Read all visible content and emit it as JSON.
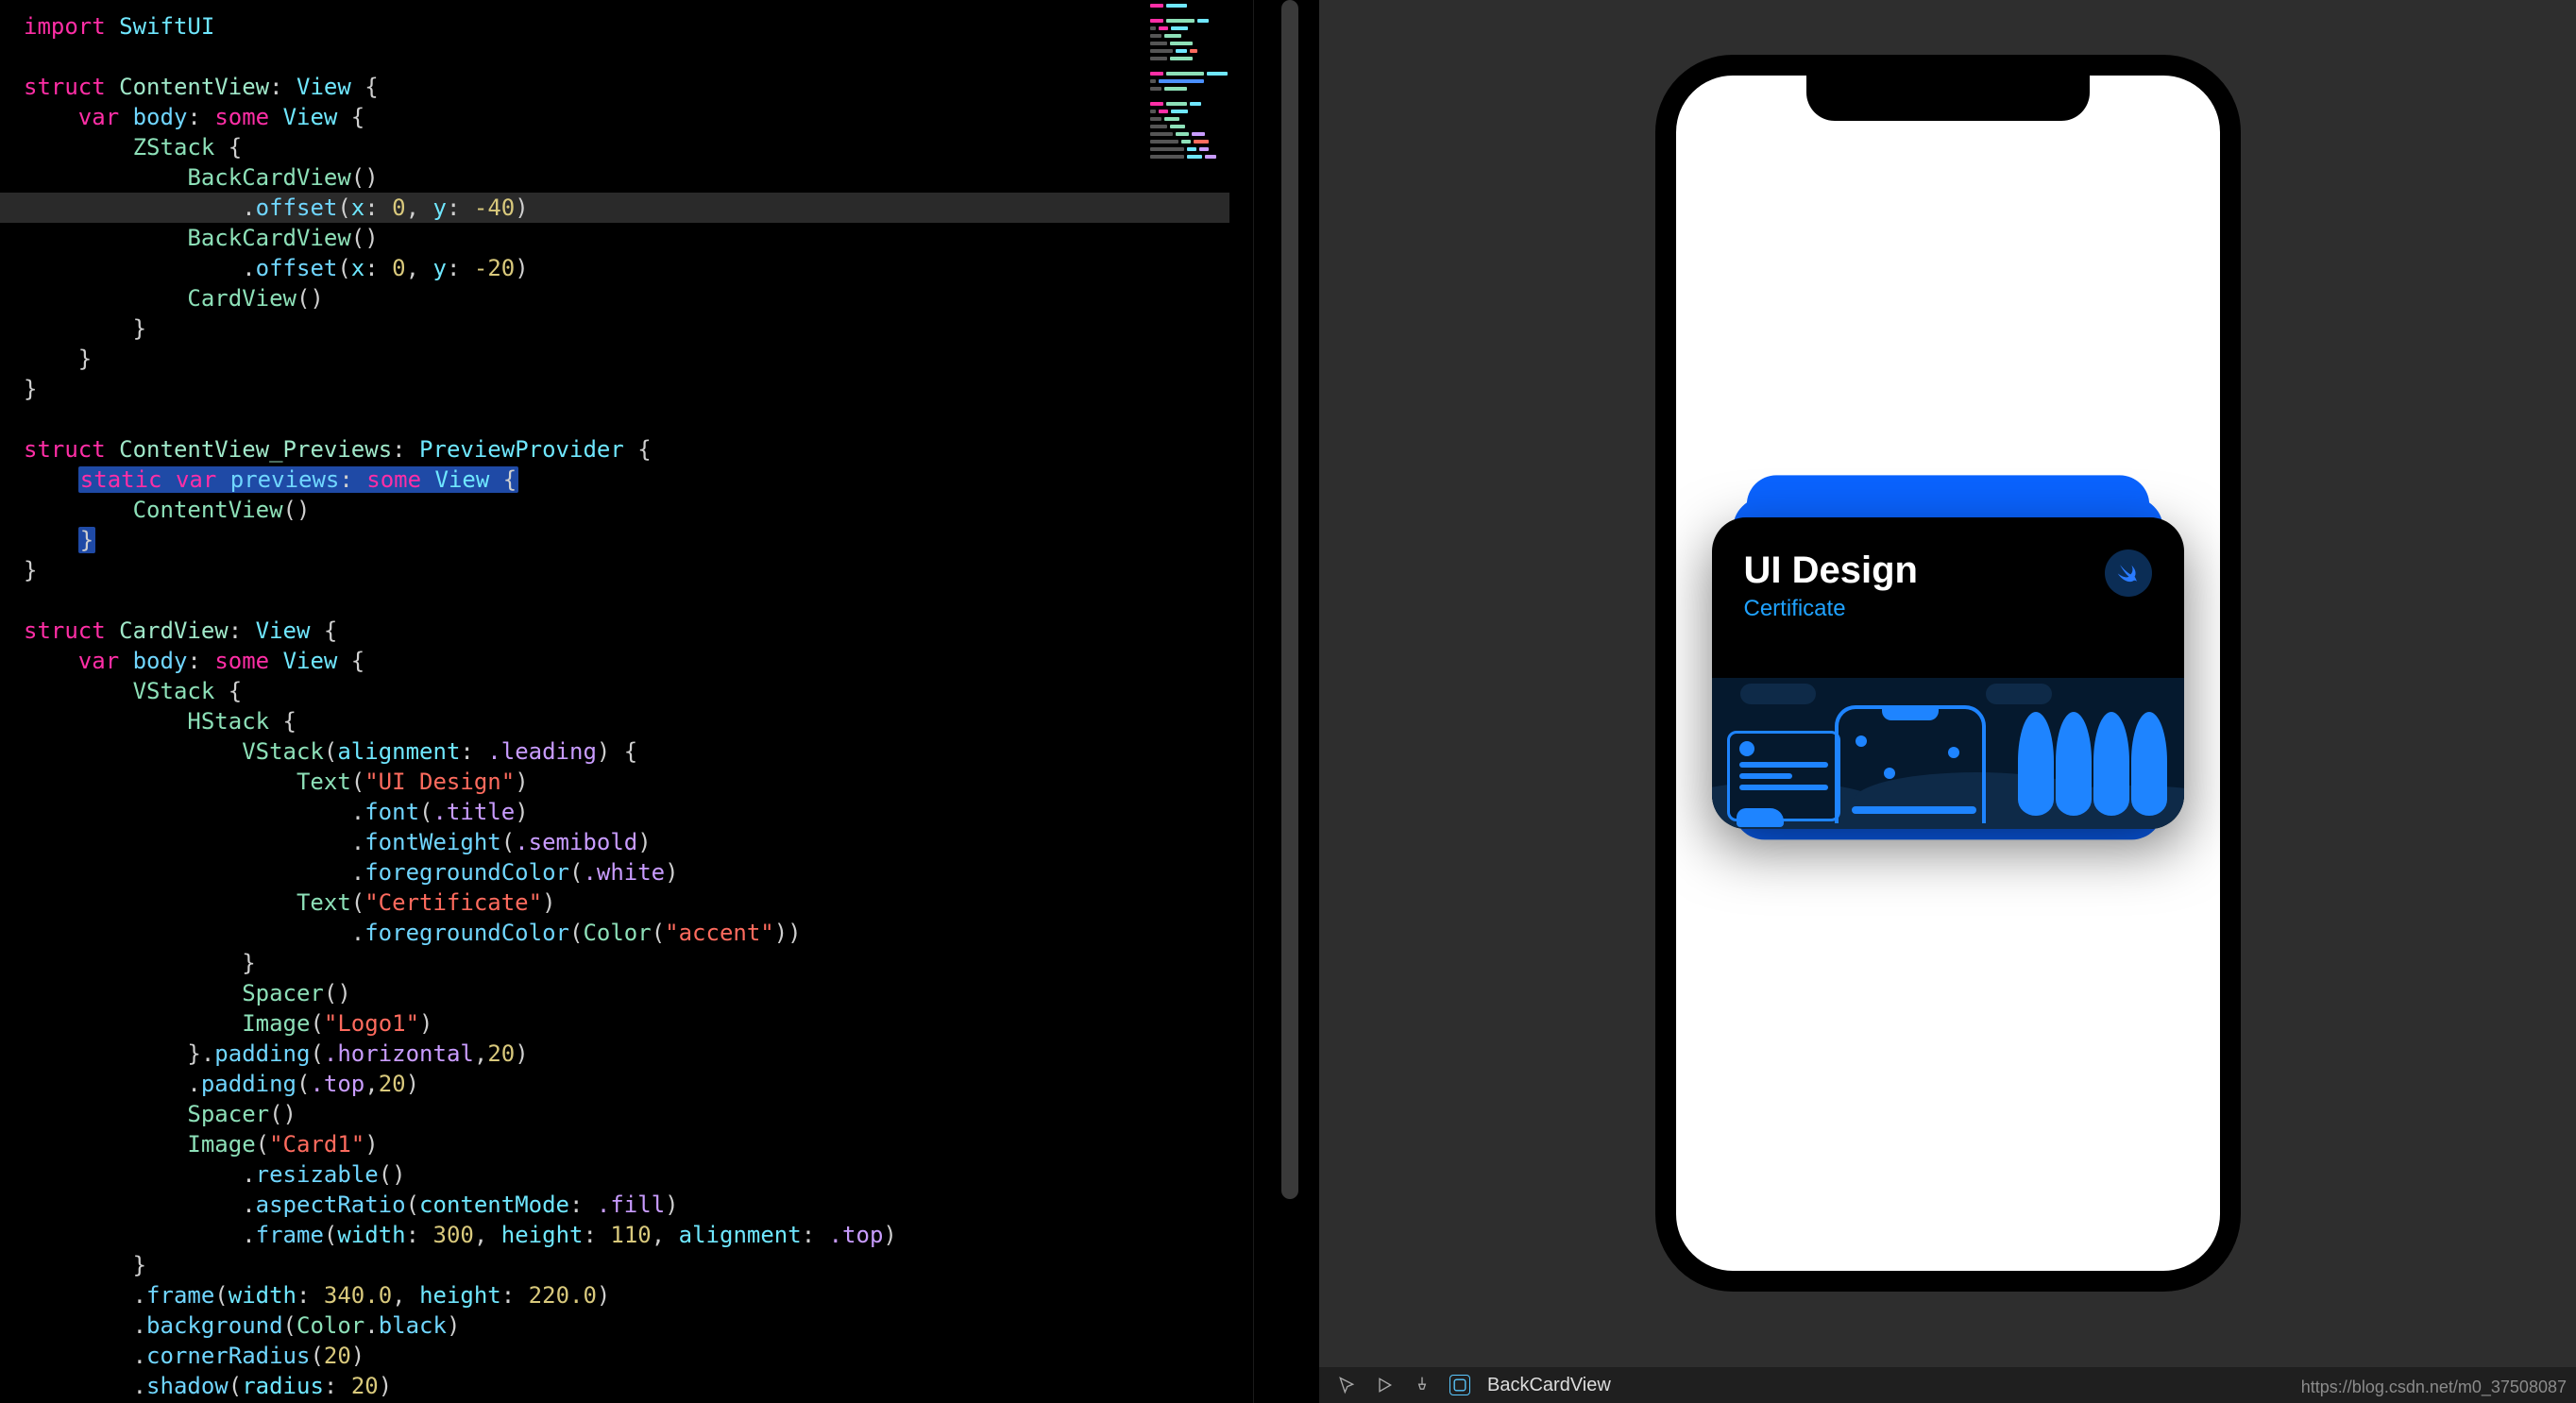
{
  "code": {
    "lines": [
      {
        "indent": 0,
        "tokens": [
          [
            "kw",
            "import"
          ],
          [
            "sp",
            " "
          ],
          [
            "type",
            "SwiftUI"
          ]
        ]
      },
      {
        "indent": 0,
        "tokens": []
      },
      {
        "indent": 0,
        "tokens": [
          [
            "kw",
            "struct"
          ],
          [
            "sp",
            " "
          ],
          [
            "dtype",
            "ContentView"
          ],
          [
            "punc",
            ": "
          ],
          [
            "type",
            "View"
          ],
          [
            "punc",
            " {"
          ]
        ]
      },
      {
        "indent": 1,
        "tokens": [
          [
            "kw",
            "var"
          ],
          [
            "sp",
            " "
          ],
          [
            "fn",
            "body"
          ],
          [
            "punc",
            ": "
          ],
          [
            "kw",
            "some"
          ],
          [
            "sp",
            " "
          ],
          [
            "type",
            "View"
          ],
          [
            "punc",
            " {"
          ]
        ]
      },
      {
        "indent": 2,
        "tokens": [
          [
            "call",
            "ZStack"
          ],
          [
            "punc",
            " {"
          ]
        ]
      },
      {
        "indent": 3,
        "tokens": [
          [
            "call",
            "BackCardView"
          ],
          [
            "punc",
            "()"
          ]
        ]
      },
      {
        "indent": 4,
        "hl": true,
        "tokens": [
          [
            "punc",
            "."
          ],
          [
            "fn",
            "offset"
          ],
          [
            "punc",
            "("
          ],
          [
            "param",
            "x"
          ],
          [
            "punc",
            ": "
          ],
          [
            "num",
            "0"
          ],
          [
            "punc",
            ", "
          ],
          [
            "param",
            "y"
          ],
          [
            "punc",
            ": "
          ],
          [
            "num",
            "-40"
          ],
          [
            "punc",
            ")"
          ]
        ]
      },
      {
        "indent": 3,
        "tokens": [
          [
            "call",
            "BackCardView"
          ],
          [
            "punc",
            "()"
          ]
        ]
      },
      {
        "indent": 4,
        "tokens": [
          [
            "punc",
            "."
          ],
          [
            "fn",
            "offset"
          ],
          [
            "punc",
            "("
          ],
          [
            "param",
            "x"
          ],
          [
            "punc",
            ": "
          ],
          [
            "num",
            "0"
          ],
          [
            "punc",
            ", "
          ],
          [
            "param",
            "y"
          ],
          [
            "punc",
            ": "
          ],
          [
            "num",
            "-20"
          ],
          [
            "punc",
            ")"
          ]
        ]
      },
      {
        "indent": 3,
        "tokens": [
          [
            "call",
            "CardView"
          ],
          [
            "punc",
            "()"
          ]
        ]
      },
      {
        "indent": 2,
        "tokens": [
          [
            "punc",
            "}"
          ]
        ]
      },
      {
        "indent": 1,
        "tokens": [
          [
            "punc",
            "}"
          ]
        ]
      },
      {
        "indent": 0,
        "tokens": [
          [
            "punc",
            "}"
          ]
        ]
      },
      {
        "indent": 0,
        "tokens": []
      },
      {
        "indent": 0,
        "tokens": [
          [
            "kw",
            "struct"
          ],
          [
            "sp",
            " "
          ],
          [
            "dtype",
            "ContentView_Previews"
          ],
          [
            "punc",
            ": "
          ],
          [
            "type",
            "PreviewProvider"
          ],
          [
            "punc",
            " {"
          ]
        ]
      },
      {
        "indent": 1,
        "sel": true,
        "tokens": [
          [
            "kw",
            "static"
          ],
          [
            "sp",
            " "
          ],
          [
            "kw",
            "var"
          ],
          [
            "sp",
            " "
          ],
          [
            "fn",
            "previews"
          ],
          [
            "punc",
            ": "
          ],
          [
            "kw",
            "some"
          ],
          [
            "sp",
            " "
          ],
          [
            "type",
            "View"
          ],
          [
            "punc",
            " {"
          ]
        ]
      },
      {
        "indent": 2,
        "tokens": [
          [
            "call",
            "ContentView"
          ],
          [
            "punc",
            "()"
          ]
        ]
      },
      {
        "indent": 1,
        "sel": true,
        "tokens": [
          [
            "punc",
            "}"
          ]
        ]
      },
      {
        "indent": 0,
        "tokens": [
          [
            "punc",
            "}"
          ]
        ]
      },
      {
        "indent": 0,
        "tokens": []
      },
      {
        "indent": 0,
        "tokens": [
          [
            "kw",
            "struct"
          ],
          [
            "sp",
            " "
          ],
          [
            "dtype",
            "CardView"
          ],
          [
            "punc",
            ": "
          ],
          [
            "type",
            "View"
          ],
          [
            "punc",
            " {"
          ]
        ]
      },
      {
        "indent": 1,
        "tokens": [
          [
            "kw",
            "var"
          ],
          [
            "sp",
            " "
          ],
          [
            "fn",
            "body"
          ],
          [
            "punc",
            ": "
          ],
          [
            "kw",
            "some"
          ],
          [
            "sp",
            " "
          ],
          [
            "type",
            "View"
          ],
          [
            "punc",
            " {"
          ]
        ]
      },
      {
        "indent": 2,
        "tokens": [
          [
            "call",
            "VStack"
          ],
          [
            "punc",
            " {"
          ]
        ]
      },
      {
        "indent": 3,
        "tokens": [
          [
            "call",
            "HStack"
          ],
          [
            "punc",
            " {"
          ]
        ]
      },
      {
        "indent": 4,
        "tokens": [
          [
            "call",
            "VStack"
          ],
          [
            "punc",
            "("
          ],
          [
            "param",
            "alignment"
          ],
          [
            "punc",
            ": "
          ],
          [
            "enum",
            ".leading"
          ],
          [
            "punc",
            ") {"
          ]
        ]
      },
      {
        "indent": 5,
        "tokens": [
          [
            "call",
            "Text"
          ],
          [
            "punc",
            "("
          ],
          [
            "str",
            "\"UI Design\""
          ],
          [
            "punc",
            ")"
          ]
        ]
      },
      {
        "indent": 6,
        "tokens": [
          [
            "punc",
            "."
          ],
          [
            "fn",
            "font"
          ],
          [
            "punc",
            "("
          ],
          [
            "enum",
            ".title"
          ],
          [
            "punc",
            ")"
          ]
        ]
      },
      {
        "indent": 6,
        "tokens": [
          [
            "punc",
            "."
          ],
          [
            "fn",
            "fontWeight"
          ],
          [
            "punc",
            "("
          ],
          [
            "enum",
            ".semibold"
          ],
          [
            "punc",
            ")"
          ]
        ]
      },
      {
        "indent": 6,
        "tokens": [
          [
            "punc",
            "."
          ],
          [
            "fn",
            "foregroundColor"
          ],
          [
            "punc",
            "("
          ],
          [
            "enum",
            ".white"
          ],
          [
            "punc",
            ")"
          ]
        ]
      },
      {
        "indent": 5,
        "tokens": [
          [
            "call",
            "Text"
          ],
          [
            "punc",
            "("
          ],
          [
            "str",
            "\"Certificate\""
          ],
          [
            "punc",
            ")"
          ]
        ]
      },
      {
        "indent": 6,
        "tokens": [
          [
            "punc",
            "."
          ],
          [
            "fn",
            "foregroundColor"
          ],
          [
            "punc",
            "("
          ],
          [
            "call",
            "Color"
          ],
          [
            "punc",
            "("
          ],
          [
            "str",
            "\"accent\""
          ],
          [
            "punc",
            "))"
          ]
        ]
      },
      {
        "indent": 4,
        "tokens": [
          [
            "punc",
            "}"
          ]
        ]
      },
      {
        "indent": 4,
        "tokens": [
          [
            "call",
            "Spacer"
          ],
          [
            "punc",
            "()"
          ]
        ]
      },
      {
        "indent": 4,
        "tokens": [
          [
            "call",
            "Image"
          ],
          [
            "punc",
            "("
          ],
          [
            "str",
            "\"Logo1\""
          ],
          [
            "punc",
            ")"
          ]
        ]
      },
      {
        "indent": 3,
        "tokens": [
          [
            "punc",
            "}."
          ],
          [
            "fn",
            "padding"
          ],
          [
            "punc",
            "("
          ],
          [
            "enum",
            ".horizontal"
          ],
          [
            "punc",
            ","
          ],
          [
            "num",
            "20"
          ],
          [
            "punc",
            ")"
          ]
        ]
      },
      {
        "indent": 3,
        "tokens": [
          [
            "punc",
            "."
          ],
          [
            "fn",
            "padding"
          ],
          [
            "punc",
            "("
          ],
          [
            "enum",
            ".top"
          ],
          [
            "punc",
            ","
          ],
          [
            "num",
            "20"
          ],
          [
            "punc",
            ")"
          ]
        ]
      },
      {
        "indent": 3,
        "tokens": [
          [
            "call",
            "Spacer"
          ],
          [
            "punc",
            "()"
          ]
        ]
      },
      {
        "indent": 3,
        "tokens": [
          [
            "call",
            "Image"
          ],
          [
            "punc",
            "("
          ],
          [
            "str",
            "\"Card1\""
          ],
          [
            "punc",
            ")"
          ]
        ]
      },
      {
        "indent": 4,
        "tokens": [
          [
            "punc",
            "."
          ],
          [
            "fn",
            "resizable"
          ],
          [
            "punc",
            "()"
          ]
        ]
      },
      {
        "indent": 4,
        "tokens": [
          [
            "punc",
            "."
          ],
          [
            "fn",
            "aspectRatio"
          ],
          [
            "punc",
            "("
          ],
          [
            "param",
            "contentMode"
          ],
          [
            "punc",
            ": "
          ],
          [
            "enum",
            ".fill"
          ],
          [
            "punc",
            ")"
          ]
        ]
      },
      {
        "indent": 4,
        "tokens": [
          [
            "punc",
            "."
          ],
          [
            "fn",
            "frame"
          ],
          [
            "punc",
            "("
          ],
          [
            "param",
            "width"
          ],
          [
            "punc",
            ": "
          ],
          [
            "num",
            "300"
          ],
          [
            "punc",
            ", "
          ],
          [
            "param",
            "height"
          ],
          [
            "punc",
            ": "
          ],
          [
            "num",
            "110"
          ],
          [
            "punc",
            ", "
          ],
          [
            "param",
            "alignment"
          ],
          [
            "punc",
            ": "
          ],
          [
            "enum",
            ".top"
          ],
          [
            "punc",
            ")"
          ]
        ]
      },
      {
        "indent": 2,
        "tokens": [
          [
            "punc",
            "}"
          ]
        ]
      },
      {
        "indent": 2,
        "tokens": [
          [
            "punc",
            "."
          ],
          [
            "fn",
            "frame"
          ],
          [
            "punc",
            "("
          ],
          [
            "param",
            "width"
          ],
          [
            "punc",
            ": "
          ],
          [
            "num",
            "340.0"
          ],
          [
            "punc",
            ", "
          ],
          [
            "param",
            "height"
          ],
          [
            "punc",
            ": "
          ],
          [
            "num",
            "220.0"
          ],
          [
            "punc",
            ")"
          ]
        ]
      },
      {
        "indent": 2,
        "tokens": [
          [
            "punc",
            "."
          ],
          [
            "fn",
            "background"
          ],
          [
            "punc",
            "("
          ],
          [
            "call",
            "Color"
          ],
          [
            "punc",
            "."
          ],
          [
            "fn",
            "black"
          ],
          [
            "punc",
            ")"
          ]
        ]
      },
      {
        "indent": 2,
        "tokens": [
          [
            "punc",
            "."
          ],
          [
            "fn",
            "cornerRadius"
          ],
          [
            "punc",
            "("
          ],
          [
            "num",
            "20"
          ],
          [
            "punc",
            ")"
          ]
        ]
      },
      {
        "indent": 2,
        "tokens": [
          [
            "punc",
            "."
          ],
          [
            "fn",
            "shadow"
          ],
          [
            "punc",
            "("
          ],
          [
            "param",
            "radius"
          ],
          [
            "punc",
            ": "
          ],
          [
            "num",
            "20"
          ],
          [
            "punc",
            ")"
          ]
        ]
      }
    ]
  },
  "preview": {
    "card_title": "UI Design",
    "card_subtitle": "Certificate"
  },
  "bottombar": {
    "label": "BackCardView"
  },
  "watermark": "https://blog.csdn.net/m0_37508087"
}
